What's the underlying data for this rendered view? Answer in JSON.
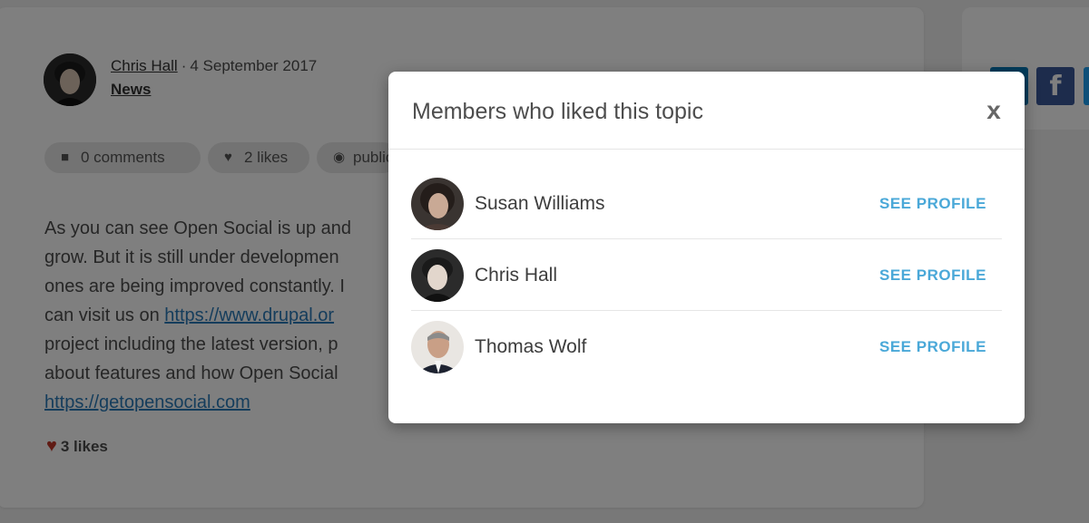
{
  "post": {
    "author": "Chris Hall",
    "separator": "·",
    "date": "4 September 2017",
    "category": "News",
    "pills": {
      "comments": "0 comments",
      "likes": "2 likes",
      "visibility": "public"
    },
    "body_lines": [
      "As you can see Open Social is up and",
      "grow. But it is still under developmen",
      "ones are being improved constantly. I",
      "can visit us on ",
      "project including the latest version, p",
      "about features and how Open Social",
      ""
    ],
    "drupal_link": "https://www.drupal.or",
    "site_link": "https://getopensocial.com",
    "likes_footer": "3 likes"
  },
  "sidebar": {
    "social_icons": [
      "linkedin-icon",
      "facebook-icon",
      "twitter-icon"
    ],
    "facebook_glyph": "f",
    "linkedin_glyph": "in",
    "twitter_glyph": "t"
  },
  "modal": {
    "title": "Members who liked this topic",
    "close_label": "x",
    "members": [
      {
        "name": "Susan Williams",
        "action": "SEE PROFILE"
      },
      {
        "name": "Chris Hall",
        "action": "SEE PROFILE"
      },
      {
        "name": "Thomas Wolf",
        "action": "SEE PROFILE"
      }
    ]
  },
  "colors": {
    "accent": "#4aa8d8",
    "link": "#2a7ab8",
    "heart": "#c0392b",
    "overlay": "rgba(0,0,0,0.5)"
  }
}
